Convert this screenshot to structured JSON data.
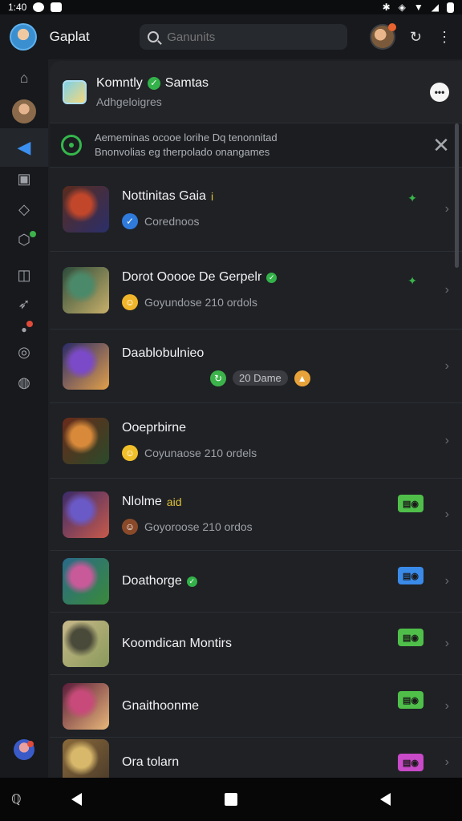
{
  "status": {
    "time": "1:40",
    "carrier_icons": [
      "app-icon-1",
      "app-icon-2"
    ],
    "right_icons": [
      "bluetooth-icon",
      "wifi-icon",
      "battery-icon"
    ]
  },
  "header": {
    "title": "Gaplat",
    "search_placeholder": "Ganunits"
  },
  "sidebar": {
    "items": [
      "home-icon",
      "user-avatar",
      "discord-icon",
      "chat-icon",
      "shield-icon",
      "game-icon",
      "image-icon",
      "rocket-icon",
      "chat-notif-icon",
      "settings-icon",
      "globe-icon"
    ]
  },
  "community": {
    "title": "Komntly",
    "title2": "Samtas",
    "subtitle": "Adhgeloigres"
  },
  "banner": {
    "line1": "Aememinas ocooe lorihe Dq tenonnitad",
    "line2": "Bnonvolias eg therpolado onangames"
  },
  "rows": [
    {
      "title": "Nottinitas Gaia",
      "title_tag": "i",
      "sub": "Corednoos",
      "sub_icon_color": "#2f7bdc",
      "mark": "star",
      "thumb": [
        "#5a2c1c",
        "#c2472a",
        "#2a2f6a"
      ]
    },
    {
      "title": "Dorot Ooooe De Gerpelr",
      "sub": "Goyundose 210 ordols",
      "sub_icon_color": "#f0b52a",
      "mark": "star",
      "thumb": [
        "#2a4a3a",
        "#4a8a6a",
        "#c8b06a"
      ]
    },
    {
      "title": "Daablobulnieo",
      "sub": "20 Dame",
      "sub_icon_color": "#3cb34a",
      "thumb": [
        "#2a2a6a",
        "#7a4ac8",
        "#e2a04a"
      ]
    },
    {
      "title": "Ooeprbirne",
      "sub": "Coyunaose 210 ordels",
      "sub_icon_color": "#f0c02a",
      "thumb": [
        "#6a2a1a",
        "#d88a3a",
        "#2a4a2a"
      ]
    },
    {
      "title": "Nlolme",
      "title_tag": "aid",
      "sub": "Goyoroose 210 ordos",
      "sub_icon_color": "#8a4a2a",
      "badge": "#4fbf4a",
      "thumb": [
        "#3a2a6a",
        "#6a5ac8",
        "#c85a4a"
      ]
    },
    {
      "title": "Doathorge",
      "sub": "",
      "badge": "#3a8ae8",
      "thumb": [
        "#2a6a8a",
        "#c85a9a",
        "#3a8a3a"
      ]
    },
    {
      "title": "Koomdican Montirs",
      "sub": "",
      "badge": "#4fbf4a",
      "thumb": [
        "#c8b88a",
        "#4a4a3a",
        "#8a9a5a"
      ]
    },
    {
      "title": "Gnaithoonme",
      "sub": "",
      "badge": "#4fbf4a",
      "thumb": [
        "#5a1a3a",
        "#c84a7a",
        "#e8b87a"
      ]
    },
    {
      "title": "Ora tolarn",
      "sub": "",
      "badge": "#c84ac8",
      "thumb": [
        "#8a6a3a",
        "#d8b86a",
        "#4a3a2a"
      ]
    }
  ]
}
